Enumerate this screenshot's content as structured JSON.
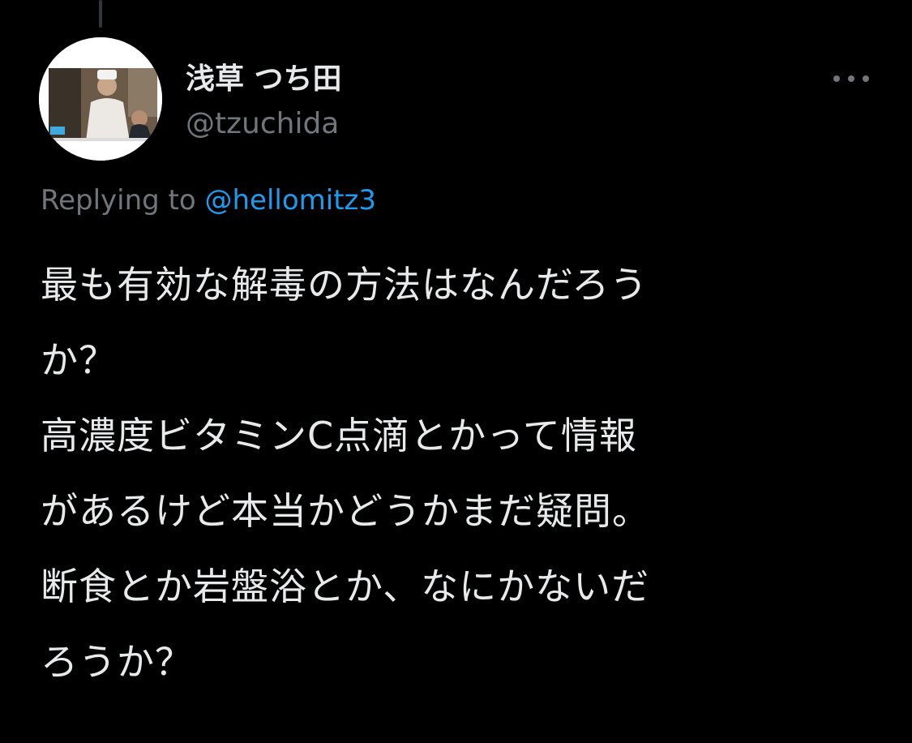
{
  "author": {
    "display_name": "浅草 つち田",
    "handle": "@tzuchida",
    "avatar_icon": "profile-photo-chef"
  },
  "reply_context": {
    "prefix": "Replying to",
    "mention": "@hellomitz3"
  },
  "tweet": {
    "lines": [
      "最も有効な解毒の方法はなんだろう",
      "か？",
      "高濃度ビタミンC点滴とかって情報",
      "があるけど本当かどうかまだ疑問。",
      "断食とか岩盤浴とか、なにかないだ",
      "ろうか？"
    ]
  },
  "colors": {
    "background": "#000000",
    "primary_text": "#e7e9ea",
    "secondary_text": "#71767b",
    "link": "#1d9bf0"
  },
  "more_icon": "more-horizontal-icon"
}
